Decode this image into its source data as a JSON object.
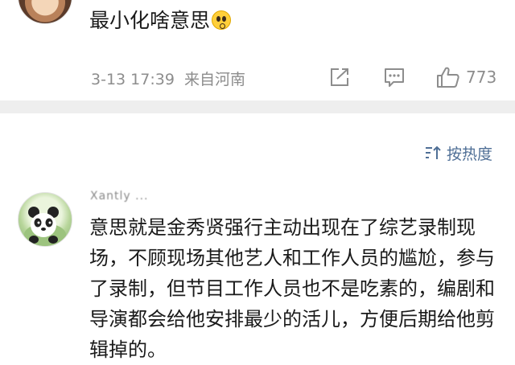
{
  "top_comment": {
    "text": "最小化啥意思",
    "emoji_icon": "surprised-face-emoji",
    "timestamp": "3-13 17:39",
    "location": "来自河南",
    "like_count": "773"
  },
  "sort": {
    "label": "按热度",
    "icon": "sort-icon",
    "accent_color": "#4f6f96"
  },
  "reply_comment": {
    "username": "Xantly  ...",
    "text": "意思就是金秀贤强行主动出现在了综艺录制现场，不顾现场其他艺人和工作人员的尴尬，参与了录制，但节目工作人员也不是吃素的，编剧和导演都会给他安排最少的活儿，方便后期给他剪辑掉的。"
  },
  "colors": {
    "text_primary": "#1a1a1a",
    "text_meta": "#8d8d8d",
    "divider": "#eeeeee"
  }
}
